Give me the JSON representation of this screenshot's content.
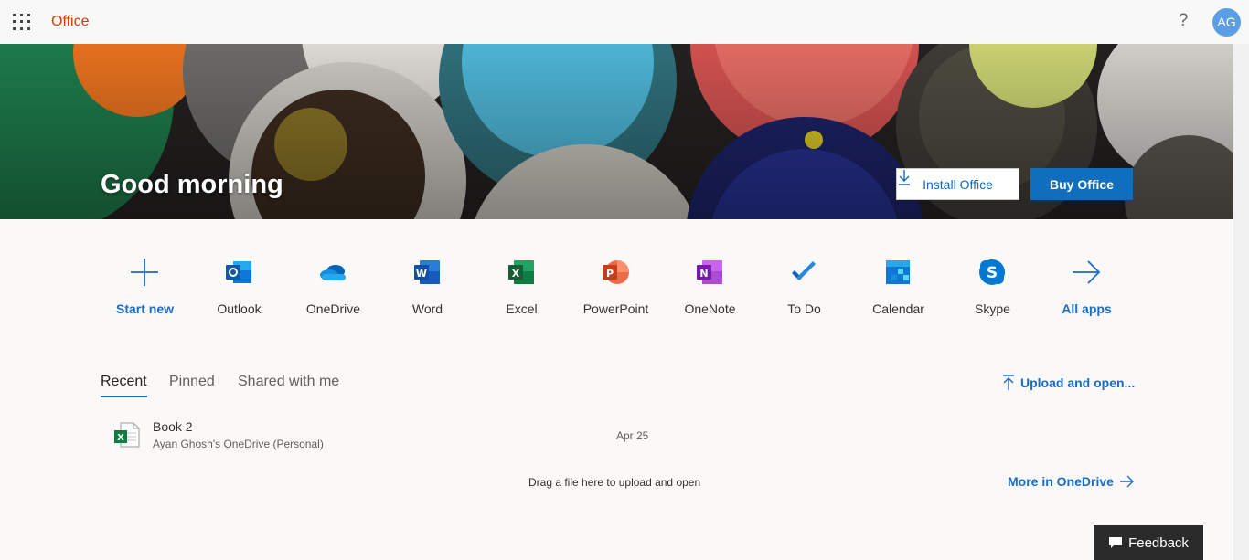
{
  "topbar": {
    "brand": "Office",
    "help": "?",
    "avatar": "AG",
    "waffle_icon": "app-launcher-icon"
  },
  "hero": {
    "greeting": "Good morning",
    "install_label": "Install Office",
    "buy_label": "Buy Office"
  },
  "apps": [
    {
      "label": "Start new",
      "icon": "plus-icon"
    },
    {
      "label": "Outlook",
      "icon": "outlook-icon"
    },
    {
      "label": "OneDrive",
      "icon": "onedrive-icon"
    },
    {
      "label": "Word",
      "icon": "word-icon"
    },
    {
      "label": "Excel",
      "icon": "excel-icon"
    },
    {
      "label": "PowerPoint",
      "icon": "powerpoint-icon"
    },
    {
      "label": "OneNote",
      "icon": "onenote-icon"
    },
    {
      "label": "To Do",
      "icon": "todo-icon"
    },
    {
      "label": "Calendar",
      "icon": "calendar-icon"
    },
    {
      "label": "Skype",
      "icon": "skype-icon"
    },
    {
      "label": "All apps",
      "icon": "arrow-right-icon"
    }
  ],
  "tabs": [
    "Recent",
    "Pinned",
    "Shared with me"
  ],
  "upload_label": "Upload and open...",
  "files": [
    {
      "name": "Book 2",
      "location": "Ayan Ghosh's OneDrive (Personal)",
      "date": "Apr 25",
      "type": "excel"
    }
  ],
  "drag_text": "Drag a file here to upload and open",
  "more_label": "More in OneDrive",
  "feedback_label": "Feedback",
  "colors": {
    "brand": "#d83b01",
    "accent": "#0f6cbd",
    "button": "#106ebe"
  }
}
